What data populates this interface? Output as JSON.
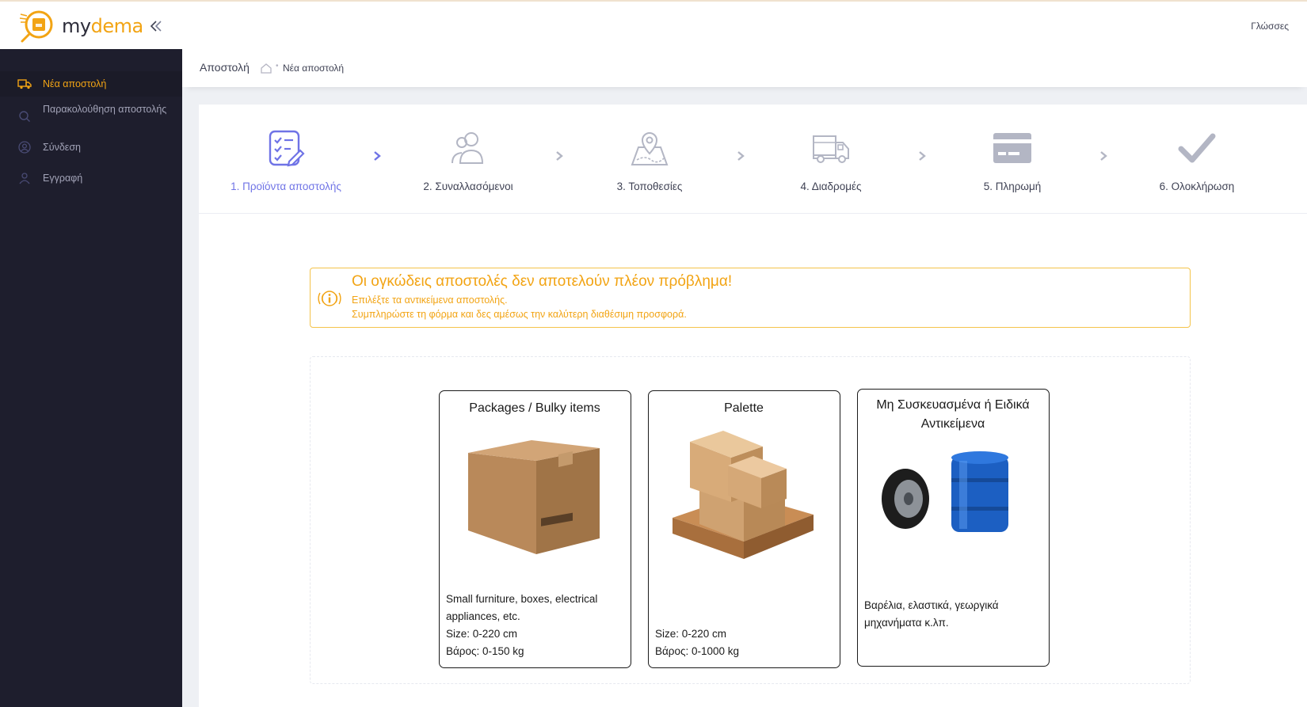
{
  "brand": {
    "name_part1": "my",
    "name_part2": "dema"
  },
  "topbar": {
    "language_label": "Γλώσσες"
  },
  "sidebar": {
    "items": [
      {
        "label": "Νέα αποστολή",
        "icon": "truck-icon"
      },
      {
        "label": "Παρακολούθηση αποστολής",
        "icon": "search-icon"
      },
      {
        "label": "Σύνδεση",
        "icon": "user-circle-icon"
      },
      {
        "label": "Εγγραφή",
        "icon": "user-icon"
      }
    ]
  },
  "subheader": {
    "title": "Αποστολή",
    "breadcrumb": "Νέα αποστολή"
  },
  "stepper": {
    "steps": [
      {
        "label": "1. Προϊόντα αποστολής",
        "icon": "checklist-icon"
      },
      {
        "label": "2. Συναλλασόμενοι",
        "icon": "users-icon"
      },
      {
        "label": "3. Τοποθεσίες",
        "icon": "map-pin-icon"
      },
      {
        "label": "4. Διαδρομές",
        "icon": "truck-icon"
      },
      {
        "label": "5. Πληρωμή",
        "icon": "credit-card-icon"
      },
      {
        "label": "6. Ολοκλήρωση",
        "icon": "check-icon"
      }
    ],
    "active_step": 1
  },
  "alert": {
    "title": "Οι ογκώδεις αποστολές δεν αποτελούν πλέον πρόβλημα!",
    "line1": "Επιλέξτε τα αντικείμενα αποστολής.",
    "line2": "Συμπληρώστε τη φόρμα και δες αμέσως την καλύτερη διαθέσιμη προσφορά."
  },
  "options": [
    {
      "title": "Packages / Bulky items",
      "desc": [
        "Small furniture, boxes, electrical",
        "appliances, etc.",
        "Size: 0-220 cm",
        "Βάρος: 0-150 kg"
      ]
    },
    {
      "title": "Palette",
      "desc": [
        "Size: 0-220 cm",
        "Βάρος: 0-1000 kg"
      ]
    },
    {
      "title_line1": "Μη Συσκευασμένα ή Ειδικά",
      "title_line2": "Αντικείμενα",
      "desc": [
        "Βαρέλια, ελαστικά, γεωργικά",
        "μηχανήματα κ.λπ."
      ]
    }
  ],
  "colors": {
    "accent": "#f2a414",
    "active_step": "#6f73e6",
    "sidebar_bg": "#1e1e2d",
    "step_icon": "#b3b6c4"
  }
}
